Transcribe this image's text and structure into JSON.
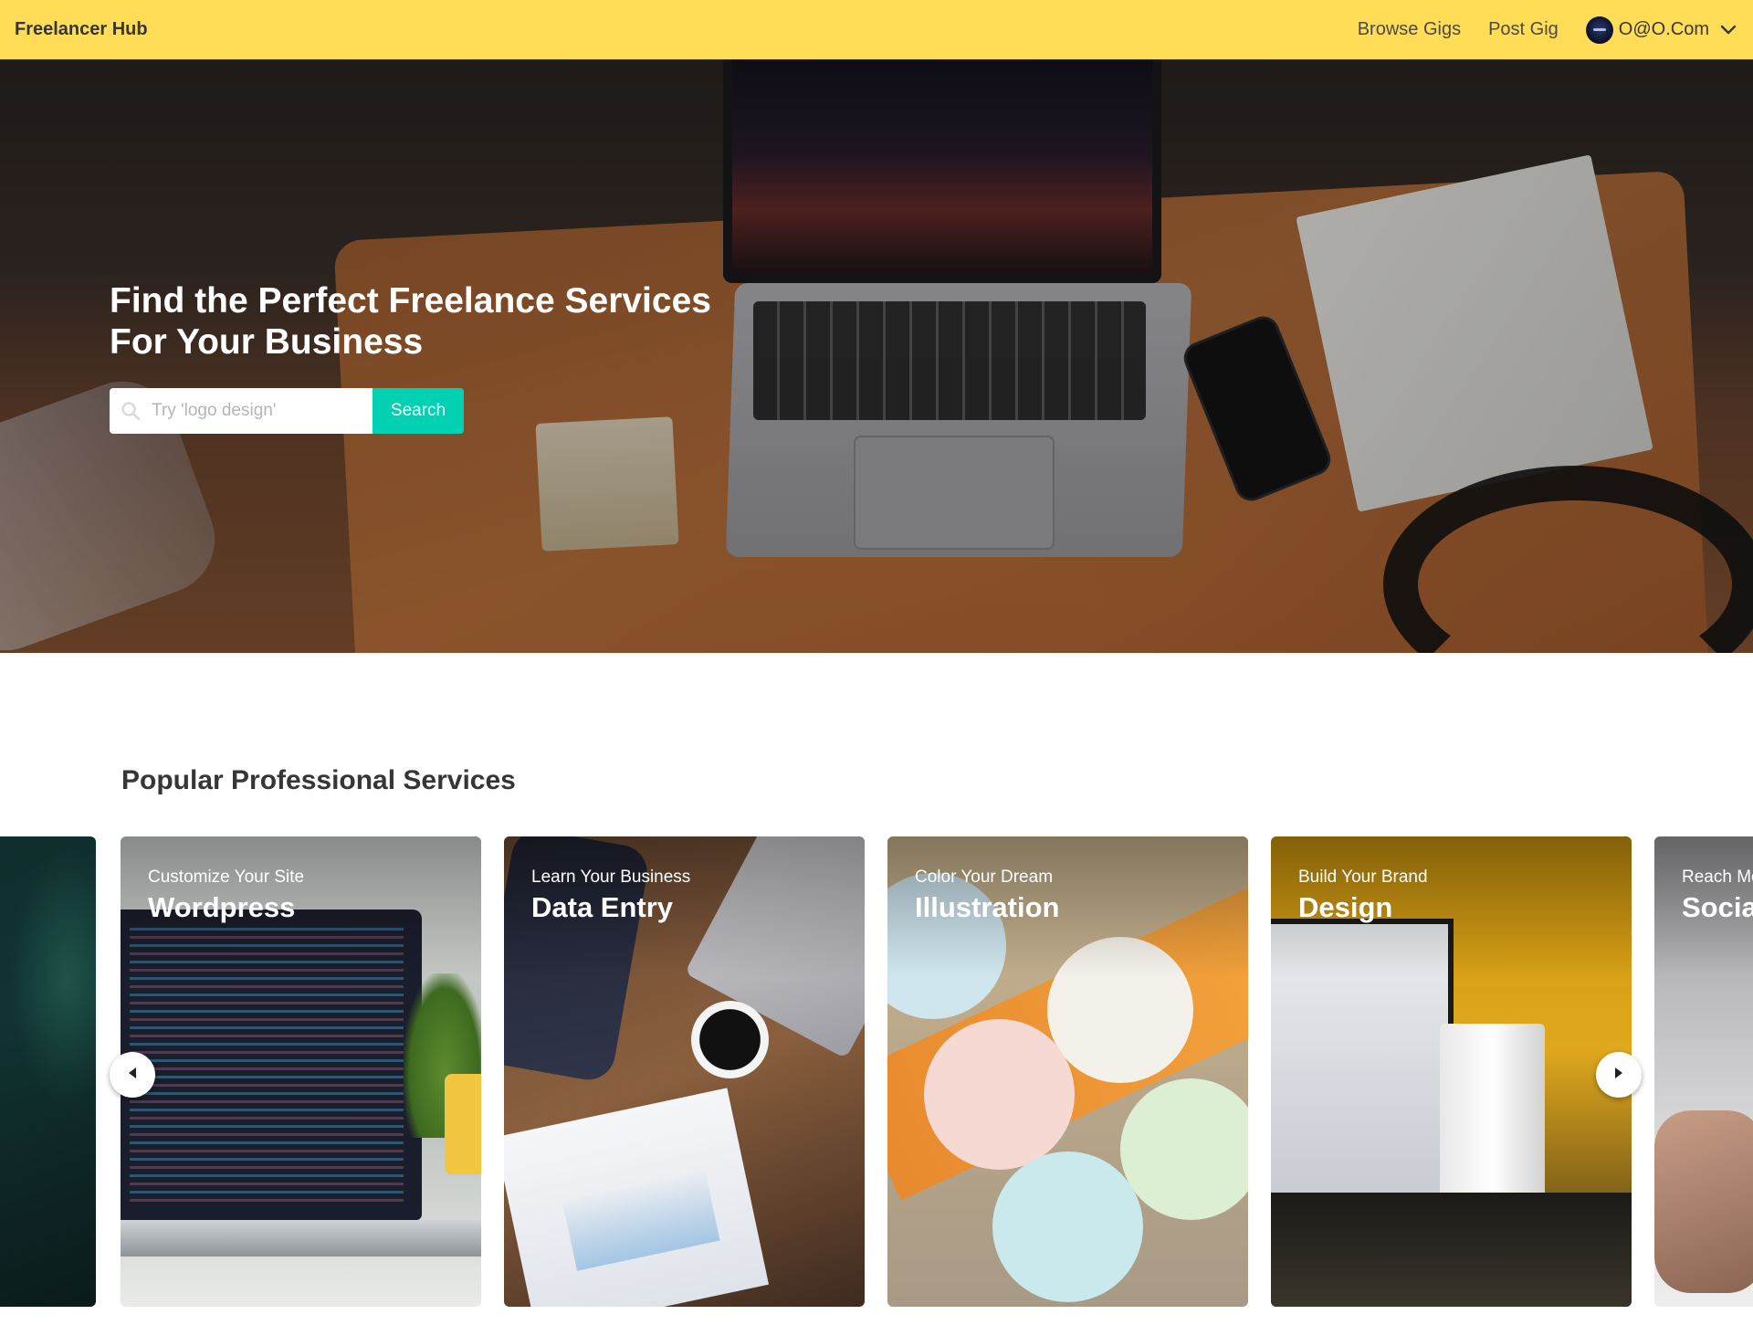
{
  "navbar": {
    "brand": "Freelancer Hub",
    "links": [
      "Browse Gigs",
      "Post Gig"
    ],
    "user_name": "O@O.Com",
    "icons": {
      "avatar": "user-avatar",
      "dropdown": "chevron-down-icon"
    },
    "background": "#ffdd57"
  },
  "hero": {
    "title_line1": "Find the Perfect Freelance Services",
    "title_line2": "For Your Business",
    "search": {
      "placeholder": "Try 'logo design'",
      "value": "",
      "icon": "search-icon",
      "button_label": "Search",
      "button_color": "#00d1b2"
    }
  },
  "services": {
    "heading": "Popular Professional Services",
    "cards": [
      {
        "subtitle": "Customize Your Site",
        "title": "Wordpress"
      },
      {
        "subtitle": "Learn Your Business",
        "title": "Data Entry"
      },
      {
        "subtitle": "Color Your Dream",
        "title": "Illustration"
      },
      {
        "subtitle": "Build Your Brand",
        "title": "Design"
      },
      {
        "subtitle": "Reach Mo",
        "title": "Social"
      }
    ],
    "arrows": {
      "prev": "chevron-left-icon",
      "next": "chevron-right-icon"
    }
  }
}
